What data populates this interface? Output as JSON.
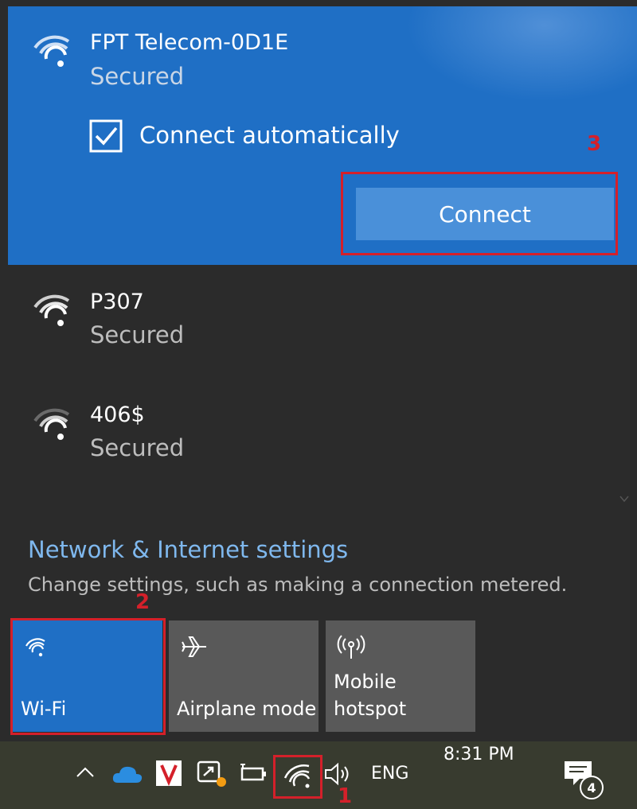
{
  "selected_network": {
    "name": "FPT Telecom-0D1E",
    "status": "Secured",
    "auto_connect_label": "Connect automatically",
    "auto_connect_checked": true,
    "connect_label": "Connect"
  },
  "networks": [
    {
      "name": "P307",
      "status": "Secured"
    },
    {
      "name": "406$",
      "status": "Secured"
    }
  ],
  "settings": {
    "title": "Network & Internet settings",
    "subtitle": "Change settings, such as making a connection metered."
  },
  "quick_actions": [
    {
      "label": "Wi-Fi",
      "icon": "wifi-icon",
      "active": true
    },
    {
      "label": "Airplane mode",
      "icon": "airplane-icon",
      "active": false
    },
    {
      "label_line1": "Mobile",
      "label_line2": "hotspot",
      "icon": "hotspot-icon",
      "active": false
    }
  ],
  "taskbar": {
    "time": "8:31 PM",
    "language": "ENG",
    "notification_count": "4"
  },
  "annotations": {
    "step1": "1",
    "step2": "2",
    "step3": "3"
  },
  "colors": {
    "accent": "#1f6fc5",
    "annotation": "#d4202a"
  }
}
